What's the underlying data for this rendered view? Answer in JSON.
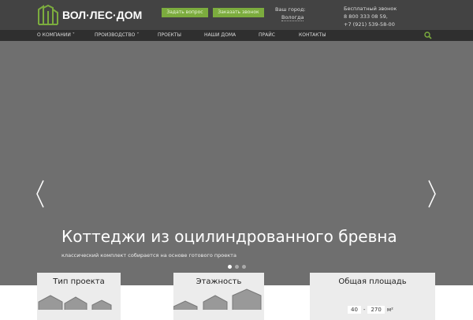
{
  "header": {
    "logo_text": "ВОЛ·ЛЕС·ДОМ",
    "ask_button": "Задать вопрос",
    "call_button": "Заказать звонок",
    "city_label": "Ваш город:",
    "city_value": "Вологда",
    "free_call_label": "Бесплатный звонок",
    "phone1": "8 800 333 08 59,",
    "phone2": "+7 (921) 539-58-00"
  },
  "nav": {
    "items": [
      "О КОМПАНИИ",
      "ПРОИЗВОДСТВО",
      "ПРОЕКТЫ",
      "НАШИ ДОМА",
      "ПРАЙС",
      "КОНТАКТЫ"
    ]
  },
  "hero": {
    "title": "Коттеджи из оцилиндрованного бревна",
    "subtitle": "классический комплект собирается на основе готового проекта",
    "slides": 3,
    "active_slide": 1
  },
  "filters": {
    "type_title": "Тип проекта",
    "floors_title": "Этажность",
    "area_title": "Общая площадь",
    "area_min": "40",
    "area_sep": "-",
    "area_max": "270",
    "area_unit": "м²"
  },
  "colors": {
    "accent": "#7cac3e"
  }
}
